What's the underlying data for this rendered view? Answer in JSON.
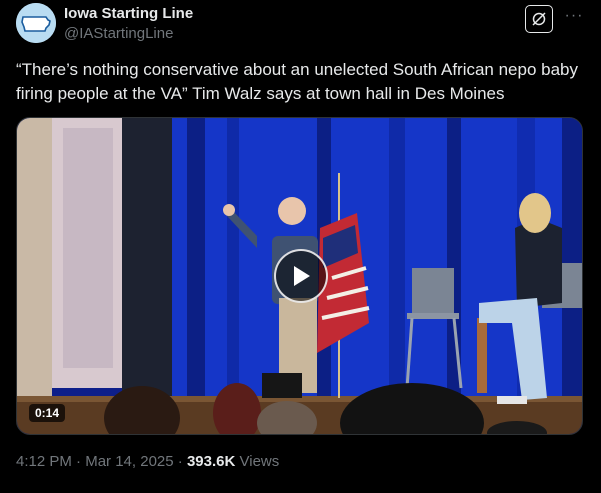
{
  "account": {
    "display_name": "Iowa Starting Line",
    "handle": "@IAStartingLine",
    "avatar_icon": "iowa-state-outline-avatar"
  },
  "tweet": {
    "text": "“There’s nothing conservative about an unelected South African nepo baby firing people at the VA” Tim Walz says at town hall in Des Moines"
  },
  "media": {
    "type": "video",
    "duration": "0:14",
    "play_icon": "play-icon"
  },
  "meta": {
    "time": "4:12 PM",
    "separator1": "·",
    "date": "Mar 14, 2025",
    "separator2": "·",
    "views_count": "393.6K",
    "views_label": "Views"
  },
  "actions": {
    "grok_icon": "grok-icon",
    "more_icon": "more-icon",
    "more_label": "···"
  },
  "colors": {
    "background": "#000000",
    "primary_text": "#e7e9ea",
    "secondary_text": "#71767b",
    "stage_curtain": "#1536c8"
  }
}
